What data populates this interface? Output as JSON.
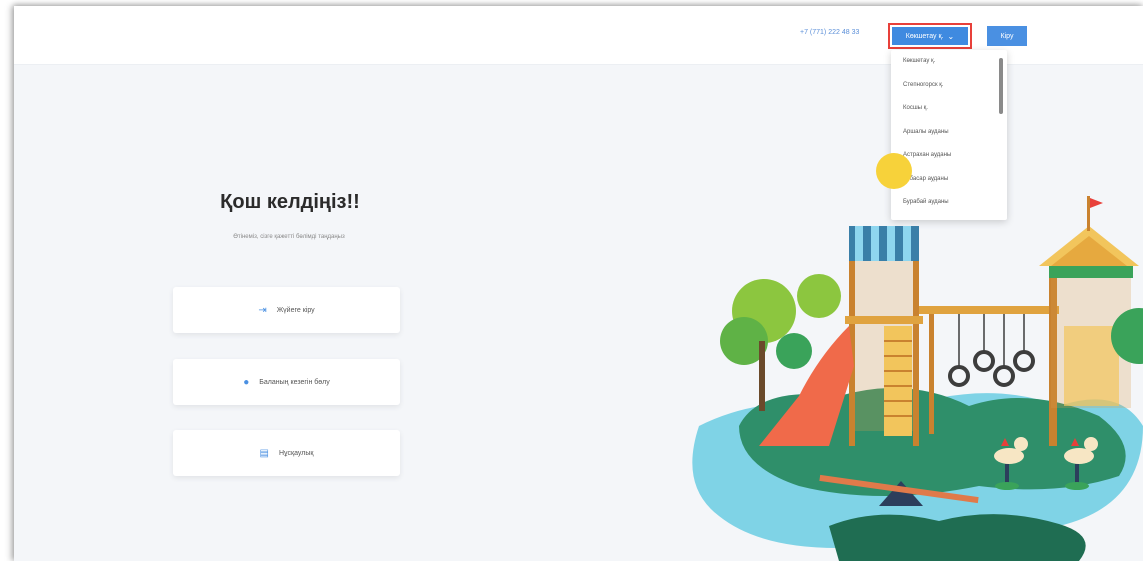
{
  "header": {
    "phone": "+7 (771) 222 48 33",
    "city_selected": "Көкшетау қ.",
    "login": "Кіру"
  },
  "city_dropdown": {
    "options": [
      "Көкшетау қ.",
      "Степногорск қ.",
      "Косшы қ.",
      "Аршалы ауданы",
      "Астрахан ауданы",
      "Атбасар ауданы",
      "Бурабай ауданы"
    ]
  },
  "main": {
    "title": "Қош келдіңіз!!",
    "subtitle": "Өтінеміз, сізге қажетті бөлімді таңдаңыз",
    "cards": [
      {
        "icon": "login-icon",
        "label": "Жүйеге кіру"
      },
      {
        "icon": "child-user-icon",
        "label": "Баланың кезегін бөлу"
      },
      {
        "icon": "document-icon",
        "label": "Нұсқаулық"
      }
    ]
  },
  "colors": {
    "accent": "#4a90e2",
    "highlight_border": "#e8403a",
    "background": "#f4f6f9"
  },
  "illustration": "playground-icon"
}
